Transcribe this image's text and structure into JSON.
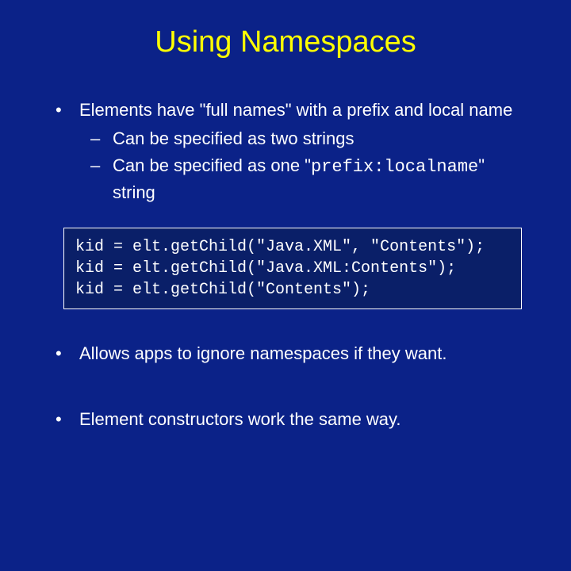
{
  "title": "Using Namespaces",
  "bullets": {
    "b1": {
      "text": "Elements have \"full names\" with a prefix and local name",
      "sub1": "Can be specified as two strings",
      "sub2a": "Can be specified as one \"",
      "sub2code": "prefix:localname",
      "sub2b": "\" string"
    },
    "b2": "Allows apps to ignore namespaces if they want.",
    "b3": "Element constructors work the same way."
  },
  "code": {
    "l1": "kid = elt.getChild(\"Java.XML\", \"Contents\");",
    "l2": "kid = elt.getChild(\"Java.XML:Contents\");",
    "l3": "kid = elt.getChild(\"Contents\");"
  }
}
